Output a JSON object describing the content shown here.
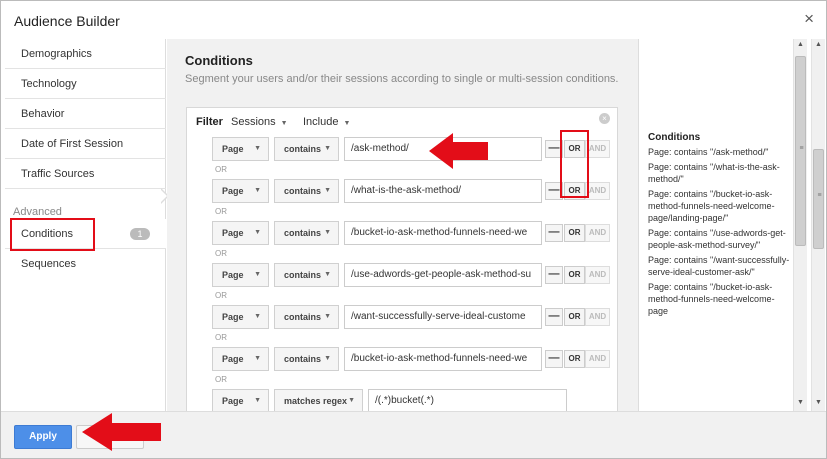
{
  "dialog": {
    "title": "Audience Builder",
    "close_icon": "×"
  },
  "sidebar": {
    "items": [
      {
        "label": "Demographics"
      },
      {
        "label": "Technology"
      },
      {
        "label": "Behavior"
      },
      {
        "label": "Date of First Session"
      },
      {
        "label": "Traffic Sources"
      }
    ],
    "advanced_label": "Advanced",
    "advanced_items": [
      {
        "label": "Conditions",
        "badge": "1"
      },
      {
        "label": "Sequences"
      }
    ]
  },
  "main": {
    "title": "Conditions",
    "subtitle": "Segment your users and/or their sessions according to single or multi-session conditions.",
    "filter": {
      "label": "Filter",
      "scope": "Sessions",
      "mode": "Include"
    },
    "or_separator": "OR",
    "minus_label": "—",
    "or_label": "OR",
    "and_label": "AND",
    "conditions": [
      {
        "dimension": "Page",
        "operator": "contains",
        "value": "/ask-method/"
      },
      {
        "dimension": "Page",
        "operator": "contains",
        "value": "/what-is-the-ask-method/"
      },
      {
        "dimension": "Page",
        "operator": "contains",
        "value": "/bucket-io-ask-method-funnels-need-we"
      },
      {
        "dimension": "Page",
        "operator": "contains",
        "value": "/use-adwords-get-people-ask-method-su"
      },
      {
        "dimension": "Page",
        "operator": "contains",
        "value": "/want-successfully-serve-ideal-custome"
      },
      {
        "dimension": "Page",
        "operator": "contains",
        "value": "/bucket-io-ask-method-funnels-need-we"
      },
      {
        "dimension": "Page",
        "operator": "matches regex",
        "value": "/(.*)bucket(.*)"
      }
    ]
  },
  "summary": {
    "title": "Conditions",
    "lines": [
      "Page: contains \"/ask-method/\"",
      "Page: contains \"/what-is-the-ask-method/\"",
      "Page: contains \"/bucket-io-ask-method-funnels-need-welcome-page/landing-page/\"",
      "Page: contains \"/use-adwords-get-people-ask-method-survey/\"",
      "Page: contains \"/want-successfully-serve-ideal-customer-ask/\"",
      "Page: contains \"/bucket-io-ask-method-funnels-need-welcome-page"
    ]
  },
  "footer": {
    "apply_label": "Apply"
  },
  "colors": {
    "accent": "#4d8fe8",
    "annotation": "#e30d18"
  }
}
